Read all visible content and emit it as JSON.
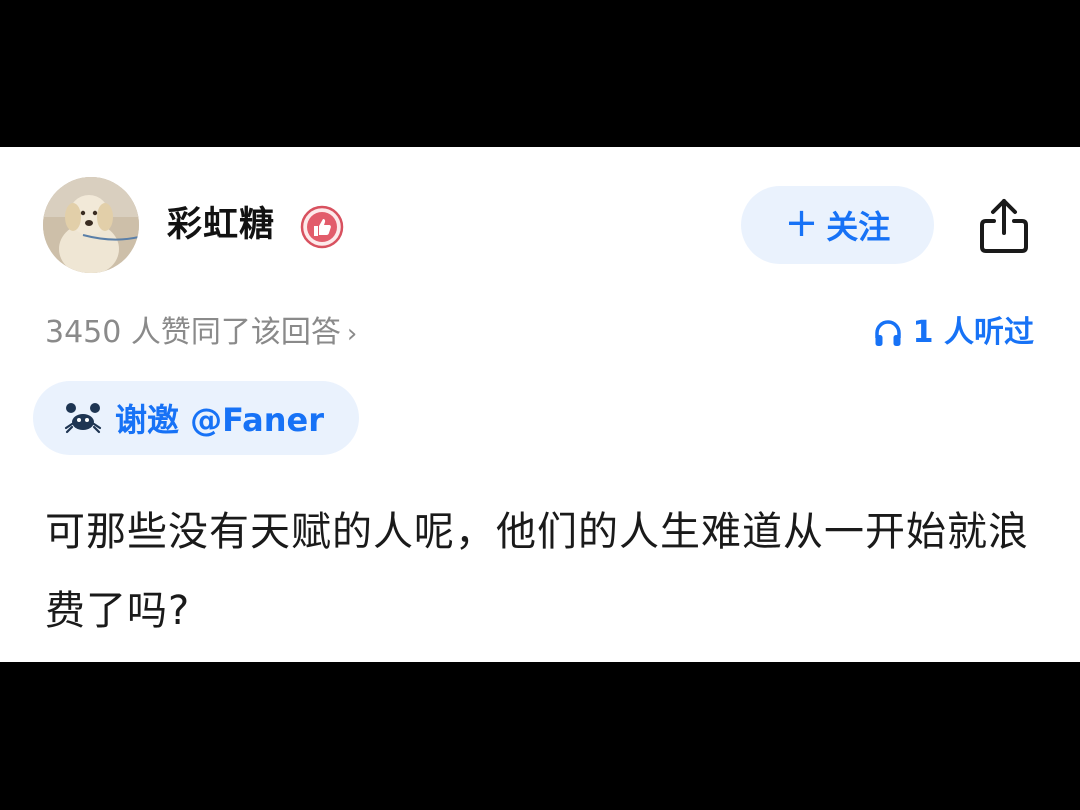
{
  "author": {
    "name": "彩虹糖",
    "avatar_icon": "golden-retriever-avatar",
    "badge_icon": "thumbs-up-badge-icon"
  },
  "actions": {
    "follow_plus": "+",
    "follow_label": "关注",
    "share_icon": "share-icon"
  },
  "stats": {
    "approvals": "3450 人赞同了该回答",
    "approvals_chevron": "›",
    "listeners": "1 人听过",
    "listen_icon": "headphones-icon"
  },
  "invite": {
    "label": "谢邀 @Faner",
    "icon": "crab-icon"
  },
  "answer": {
    "text": "可那些没有天赋的人呢，他们的人生难道从一开始就浪费了吗?"
  },
  "colors": {
    "accent": "#1772f6",
    "accent_bg": "#eaf2fd",
    "badge": "#e25c6b"
  }
}
